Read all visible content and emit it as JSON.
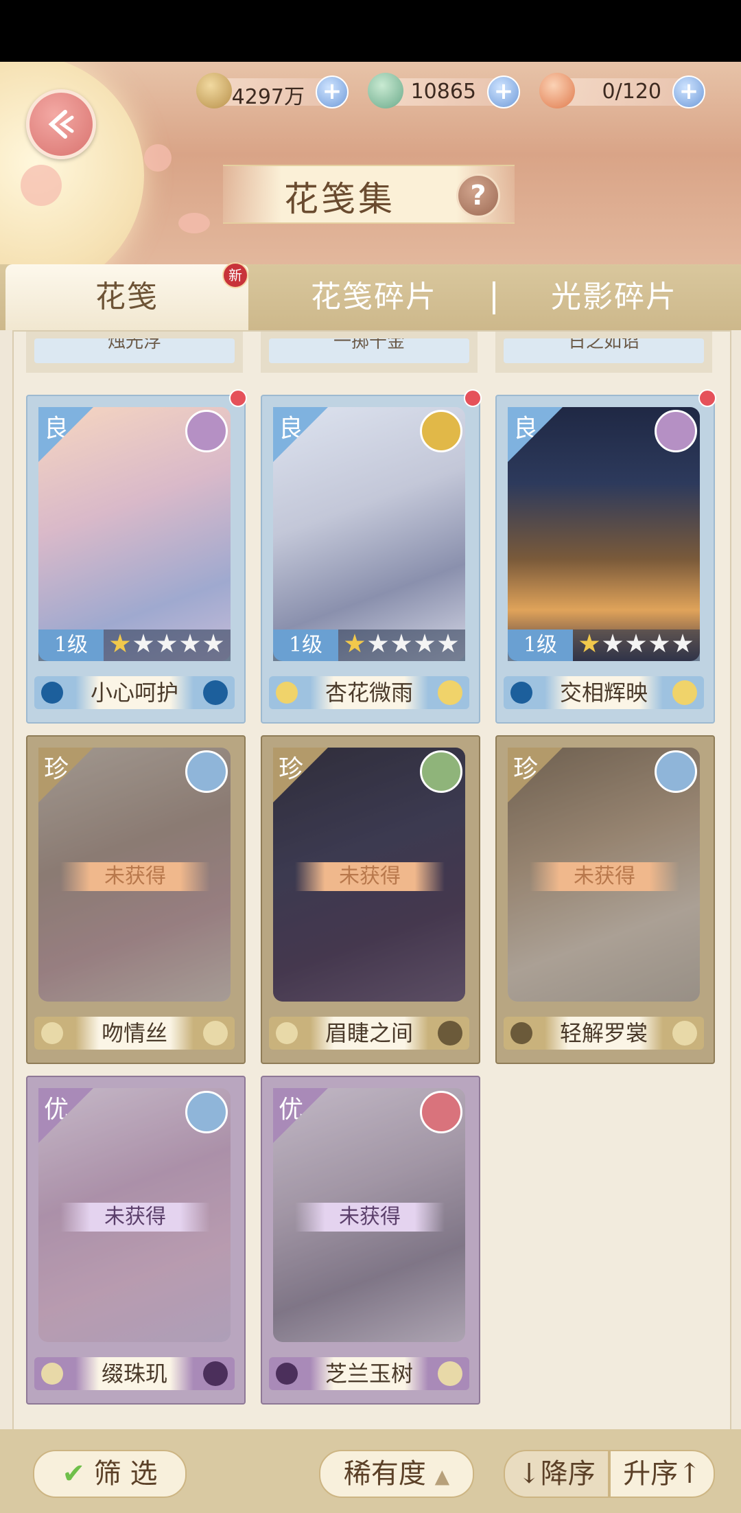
{
  "header": {
    "title": "花笺集",
    "help_label": "?",
    "resources": [
      {
        "icon": "paw-coin-icon",
        "value": "4297万",
        "plus": "+"
      },
      {
        "icon": "jade-icon",
        "value": "10865",
        "plus": "+"
      },
      {
        "icon": "food-bowl-icon",
        "value": "0/120",
        "plus": "+"
      }
    ]
  },
  "tabs": [
    {
      "label": "花笺",
      "active": true,
      "badge": "新"
    },
    {
      "label": "花笺碎片",
      "active": false
    },
    {
      "label": "光影碎片",
      "active": false
    }
  ],
  "partial_row": [
    "烛光浮",
    "一掷千金",
    "日之如诏"
  ],
  "cards": [
    {
      "rarity": "良",
      "level": "1级",
      "stars_lit": 1,
      "stars_total": 5,
      "name": "小心呵护",
      "emblem": "scales-icon",
      "owned": true,
      "new_dot": true
    },
    {
      "rarity": "良",
      "level": "1级",
      "stars_lit": 1,
      "stars_total": 5,
      "name": "杏花微雨",
      "emblem": "bird-icon",
      "owned": true,
      "new_dot": true
    },
    {
      "rarity": "良",
      "level": "1级",
      "stars_lit": 1,
      "stars_total": 5,
      "name": "交相辉映",
      "emblem": "scales-icon",
      "owned": true,
      "new_dot": true
    },
    {
      "rarity": "珍",
      "status": "未获得",
      "name": "吻情丝",
      "emblem": "flame-icon",
      "owned": false
    },
    {
      "rarity": "珍",
      "status": "未获得",
      "name": "眉睫之间",
      "emblem": "diamond-icon",
      "owned": false
    },
    {
      "rarity": "珍",
      "status": "未获得",
      "name": "轻解罗裳",
      "emblem": "flame-icon",
      "owned": false
    },
    {
      "rarity": "优",
      "status": "未获得",
      "name": "缀珠玑",
      "emblem": "flame-icon",
      "owned": false
    },
    {
      "rarity": "优",
      "status": "未获得",
      "name": "芝兰玉树",
      "emblem": "heart-icon",
      "owned": false
    }
  ],
  "footer": {
    "filter_label": "筛 选",
    "sort_label": "稀有度",
    "desc_label": "↓降序",
    "asc_label": "升序↑"
  },
  "colors": {
    "blue_tier": "#8fb6d9",
    "gold_tier": "#b39a6a",
    "purple_tier": "#a98ab8",
    "accent_red": "#e5515a"
  }
}
